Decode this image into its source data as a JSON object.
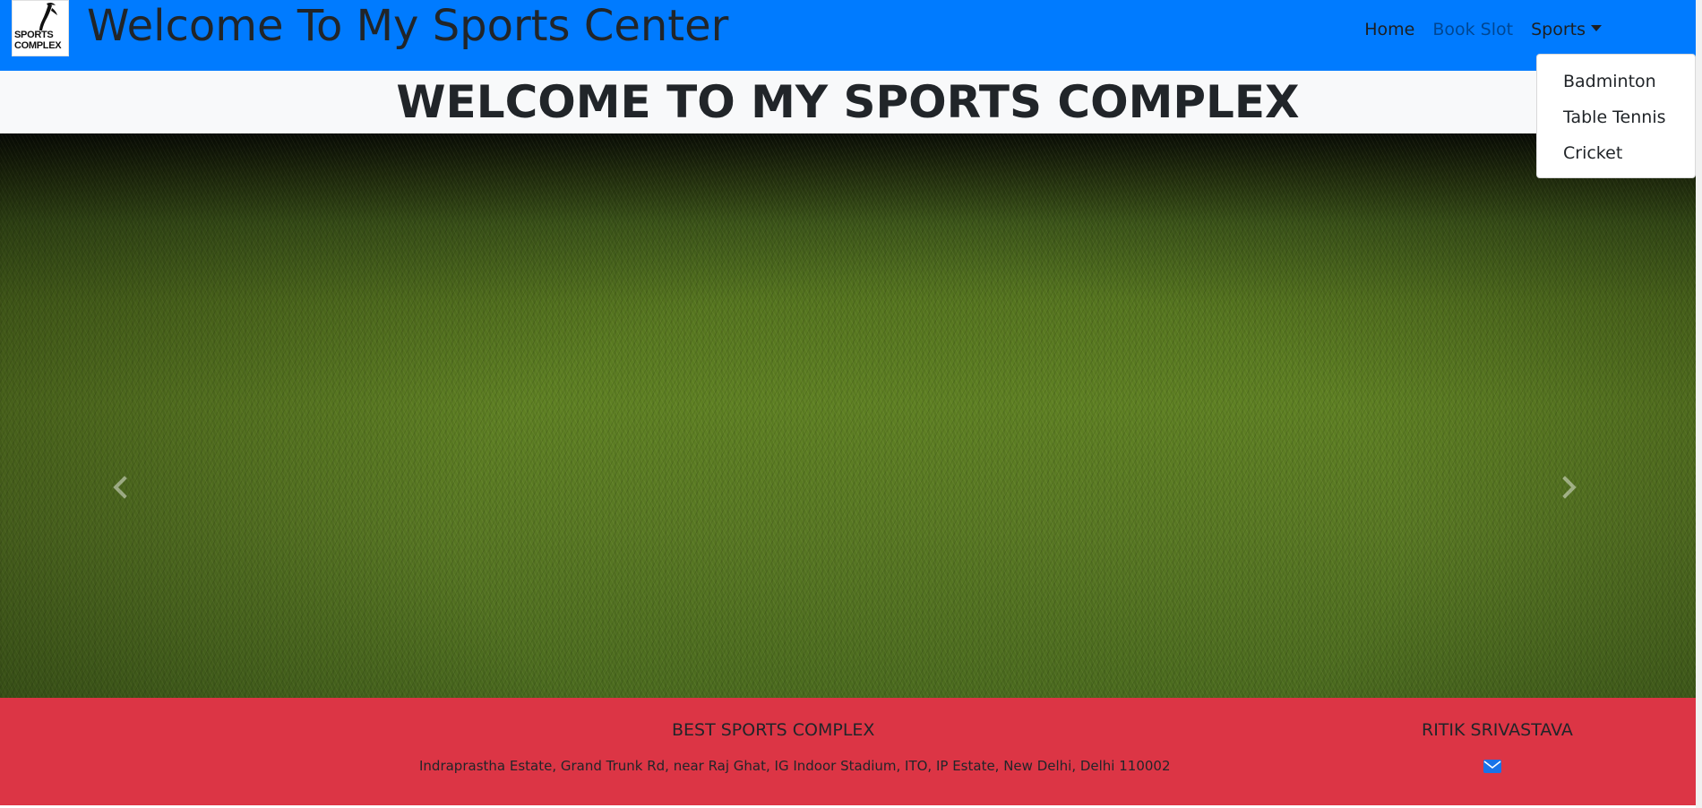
{
  "navbar": {
    "logo_text_line1": "SPORTS",
    "logo_text_line2": "COMPLEX",
    "title": "Welcome To My Sports Center",
    "links": {
      "home": "Home",
      "book_slot": "Book Slot",
      "sports": "Sports"
    },
    "brand_color": "#007bff"
  },
  "dropdown": {
    "items": [
      "Badminton",
      "Table Tennis",
      "Cricket"
    ]
  },
  "heading": {
    "text": "WELCOME TO MY SPORTS COMPLEX"
  },
  "carousel": {
    "prev_icon": "chevron-left-icon",
    "next_icon": "chevron-right-icon"
  },
  "footer": {
    "left_title": "BEST SPORTS COMPLEX",
    "address": "Indraprastha Estate, Grand Trunk Rd, near Raj Ghat, IG Indoor Stadium, ITO, IP Estate, New Delhi, Delhi 110002",
    "right_title": "RITIK SRIVASTAVA",
    "mail_icon": "envelope-icon",
    "background_color": "#dc3545"
  }
}
